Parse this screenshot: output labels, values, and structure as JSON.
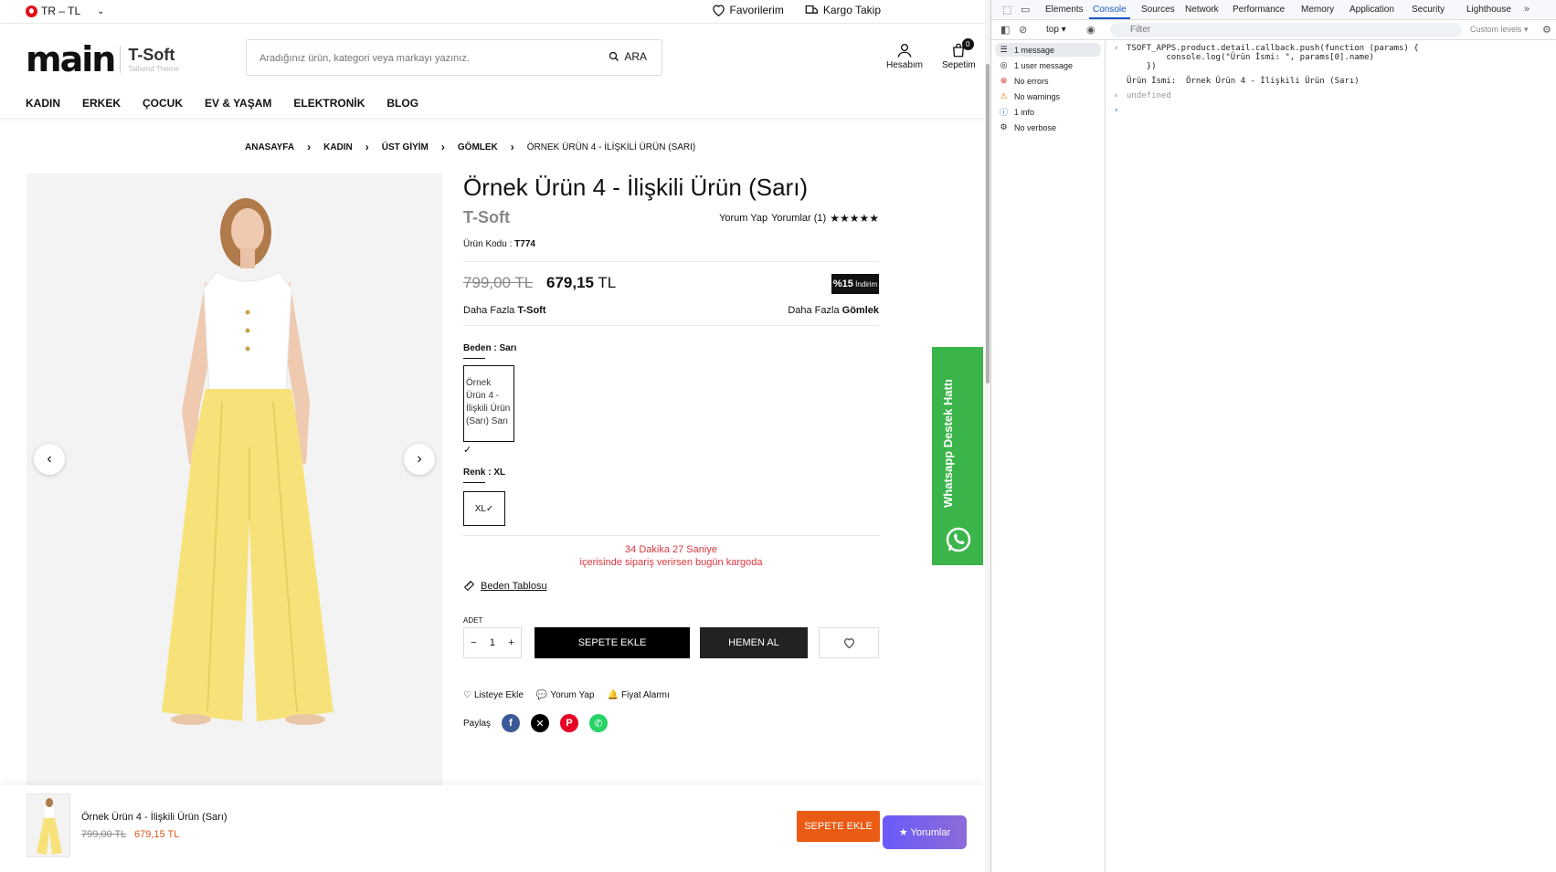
{
  "topbar": {
    "currency": "TR – TL",
    "favorites": "Favorilerim",
    "cargo": "Kargo Takip"
  },
  "header": {
    "logo_main": "main",
    "logo_brand": "T-Soft",
    "logo_sub": "Tailwind Theme",
    "search_placeholder": "Aradığınız ürün, kategori veya markayı yazınız.",
    "search_button": "ARA",
    "account": "Hesabım",
    "cart": "Sepetim",
    "cart_count": "0"
  },
  "nav": [
    "KADIN",
    "ERKEK",
    "ÇOCUK",
    "EV & YAŞAM",
    "ELEKTRONİK",
    "BLOG"
  ],
  "breadcrumb": [
    "ANASAYFA",
    "KADIN",
    "ÜST GİYİM",
    "GÖMLEK",
    "ÖRNEK ÜRÜN 4 - İLİŞKİLİ ÜRÜN (SARI)"
  ],
  "product": {
    "title": "Örnek Ürün 4 - İlişkili Ürün (Sarı)",
    "brand": "T-Soft",
    "review_link": "Yorum Yap",
    "reviews_count": "Yorumlar (1)",
    "rating_stars": 5,
    "code_label": "Ürün Kodu :",
    "code": "T774",
    "old_price": "799,00 TL",
    "new_price_value": "679,15",
    "new_price_currency": "TL",
    "discount_value": "%15",
    "discount_label": "İndirim",
    "more_brand_prefix": "Daha Fazla",
    "more_brand": "T-Soft",
    "more_cat_prefix": "Daha Fazla",
    "more_cat": "Gömlek",
    "size_label": "Beden : Sarı",
    "swatch_alt": "Örnek Ürün 4 - İlişkili Ürün (Sarı) Sarı",
    "color_label": "Renk : XL",
    "size_option": "XL",
    "countdown_line1": "34 Dakika 27 Saniye",
    "countdown_line2": "içerisinde sipariş verirsen bugün kargoda",
    "size_table": "Beden Tablosu",
    "qty_label": "ADET",
    "qty": "1",
    "add_to_cart": "SEPETE EKLE",
    "buy_now": "HEMEN AL",
    "wishlist": "Listeye Ekle",
    "comment": "Yorum Yap",
    "price_alert": "Fiyat Alarmı",
    "share_label": "Paylaş"
  },
  "whatsapp_tab": "Whatsapp Destek Hattı",
  "sticky": {
    "name": "Örnek Ürün 4 - İlişkili Ürün (Sarı)",
    "old_price": "799,00 TL",
    "new_price": "679,15 TL",
    "add": "SEPETE EKLE",
    "reviews": "★ Yorumlar"
  },
  "devtools": {
    "tabs": [
      "Elements",
      "Console",
      "Sources",
      "Network",
      "Performance",
      "Memory",
      "Application",
      "Security",
      "Lighthouse"
    ],
    "active_tab": "Console",
    "context": "top",
    "filter_placeholder": "Filter",
    "levels": "Custom levels",
    "sidebar": [
      {
        "label": "1 message",
        "icon": "list-icon"
      },
      {
        "label": "1 user message",
        "icon": "user-icon"
      },
      {
        "label": "No errors",
        "icon": "error-icon"
      },
      {
        "label": "No warnings",
        "icon": "warning-icon"
      },
      {
        "label": "1 info",
        "icon": "info-icon"
      },
      {
        "label": "No verbose",
        "icon": "verbose-icon"
      }
    ],
    "console": {
      "line1": "TSOFT_APPS.product.detail.callback.push(function (params) {",
      "line2": "        console.log(\"Ürün İsmi: \", params[0].name)",
      "line3": "    })",
      "output": "Ürün İsmi:  Örnek Ürün 4 - İlişkili Ürün (Sarı)",
      "return": "undefined"
    }
  }
}
